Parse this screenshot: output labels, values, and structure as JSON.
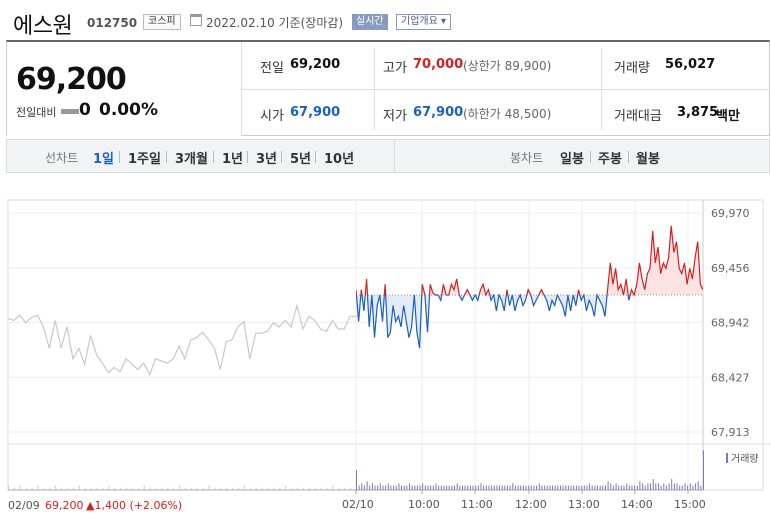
{
  "header": {
    "name": "에스원",
    "code": "012750",
    "market": "코스피",
    "date": "2022.02.10 기준(장마감)",
    "realtime": "실시간",
    "company_info": "기업개요 ▾"
  },
  "summary": {
    "price": "69,200",
    "change_label": "전일대비",
    "change_value": "0",
    "change_pct": "0.00%",
    "prev_label": "전일",
    "prev_value": "69,200",
    "open_label": "시가",
    "open_value": "67,900",
    "high_label": "고가",
    "high_value": "70,000",
    "upper_limit": "(상한가 89,900)",
    "low_label": "저가",
    "low_value": "67,900",
    "lower_limit": "(하한가 48,500)",
    "volume_label": "거래량",
    "volume_value": "56,027",
    "amount_label": "거래대금",
    "amount_value": "3,875",
    "amount_unit": "백만"
  },
  "period_bar": {
    "line_chart_label": "선차트",
    "line_items": [
      "1일",
      "1주일",
      "3개월",
      "1년",
      "3년",
      "5년",
      "10년"
    ],
    "active": "1일",
    "candle_label": "봉차트",
    "candle_items": [
      "일봉",
      "주봉",
      "월봉"
    ]
  },
  "footer": {
    "prev_date": "02/09",
    "prev_price": "69,200",
    "prev_change": "▲1,400 (+2.06%)"
  },
  "colors": {
    "up": "#d61f1f",
    "down": "#1b5fbf",
    "prev_line": "#c8c8c8",
    "up_fill": "#fbe3e3",
    "down_fill": "#e2ebf7",
    "volume": "#7a7ab8"
  },
  "chart_data": {
    "type": "line",
    "y_ticks": [
      "69,970",
      "69,456",
      "68,942",
      "68,427",
      "67,913"
    ],
    "ylim": [
      67913,
      69970
    ],
    "base_price": 69200,
    "x_ticks": [
      "02/10",
      "10:00",
      "11:00",
      "12:00",
      "13:00",
      "14:00",
      "15:00"
    ],
    "volume_label": "거래량",
    "prev_day_series": [
      68980,
      68960,
      69010,
      68940,
      68990,
      69010,
      68900,
      68700,
      68960,
      68700,
      68900,
      68600,
      68700,
      68550,
      68820,
      68640,
      68560,
      68470,
      68520,
      68480,
      68600,
      68550,
      68500,
      68560,
      68450,
      68600,
      68580,
      68560,
      68600,
      68720,
      68600,
      68780,
      68800,
      68850,
      68780,
      68700,
      68500,
      68760,
      68780,
      68900,
      68950,
      68600,
      68840,
      68840,
      68860,
      68940,
      68900,
      68960,
      68900,
      69100,
      68880,
      69000,
      68960,
      68880,
      68860,
      68960,
      68880,
      68880,
      69000,
      69000
    ],
    "today_series": [
      69250,
      68950,
      69250,
      69050,
      69350,
      68900,
      69200,
      68800,
      69100,
      69200,
      68950,
      69300,
      68800,
      68850,
      69100,
      68950,
      69000,
      68900,
      69100,
      68950,
      68800,
      68900,
      69200,
      68850,
      68700,
      69300,
      69200,
      68850,
      69300,
      69220,
      69200,
      69200,
      69150,
      69300,
      69200,
      69200,
      69300,
      69250,
      69350,
      69200,
      69150,
      69200,
      69250,
      69200,
      69150,
      69200,
      69150,
      69250,
      69300,
      69200,
      69250,
      69150,
      69200,
      69050,
      69200,
      69150,
      69050,
      69250,
      69100,
      69200,
      69050,
      69150,
      69200,
      69100,
      69150,
      69250,
      69200,
      69100,
      69150,
      69200,
      69250,
      69200,
      69150,
      69050,
      69150,
      69100,
      69200,
      69150,
      69100,
      69000,
      69200,
      69050,
      69200,
      69100,
      69250,
      69150,
      69200,
      69050,
      69150,
      69100,
      69000,
      69200,
      69150,
      69100,
      69000,
      69250,
      69500,
      69300,
      69450,
      69250,
      69300,
      69200,
      69350,
      69150,
      69250,
      69200,
      69300,
      69500,
      69350,
      69250,
      69400,
      69450,
      69800,
      69500,
      69650,
      69400,
      69500,
      69450,
      69550,
      69850,
      69600,
      69700,
      69450,
      69400,
      69500,
      69300,
      69450,
      69350,
      69550,
      69700,
      69300,
      69250
    ],
    "volume_today": [
      9,
      2,
      3,
      2,
      4,
      2,
      3,
      2,
      2,
      3,
      2,
      2,
      3,
      2,
      2,
      2,
      3,
      2,
      2,
      2,
      3,
      2,
      2,
      2,
      2,
      3,
      2,
      2,
      2,
      2,
      3,
      2,
      2,
      2,
      2,
      2,
      2,
      2,
      3,
      2,
      2,
      2,
      2,
      2,
      2,
      2,
      2,
      3,
      2,
      2,
      2,
      2,
      2,
      2,
      2,
      2,
      2,
      2,
      2,
      3,
      2,
      2,
      2,
      2,
      2,
      2,
      2,
      2,
      2,
      3,
      2,
      2,
      2,
      2,
      2,
      2,
      2,
      2,
      2,
      2,
      2,
      2,
      2,
      2,
      2,
      2,
      2,
      2,
      3,
      2,
      2,
      2,
      2,
      2,
      2,
      4,
      3,
      2,
      3,
      2,
      2,
      2,
      3,
      2,
      2,
      2,
      2,
      4,
      3,
      2,
      3,
      3,
      5,
      3,
      3,
      2,
      3,
      2,
      3,
      5,
      3,
      3,
      2,
      2,
      3,
      2,
      3,
      2,
      3,
      4,
      2,
      18
    ],
    "volume_prev": [
      2,
      1,
      2,
      1,
      1,
      2,
      1,
      1,
      2,
      1,
      1,
      1,
      2,
      1,
      1,
      1,
      1,
      2,
      1,
      1,
      1,
      1,
      1,
      2,
      1,
      1,
      1,
      1,
      1,
      2,
      1,
      1,
      1,
      1,
      2,
      1,
      1,
      1,
      1,
      1,
      2,
      1,
      1,
      1,
      1,
      1,
      1,
      2,
      1,
      1,
      1,
      1,
      1,
      1,
      1,
      2,
      1,
      1,
      1,
      1
    ]
  }
}
